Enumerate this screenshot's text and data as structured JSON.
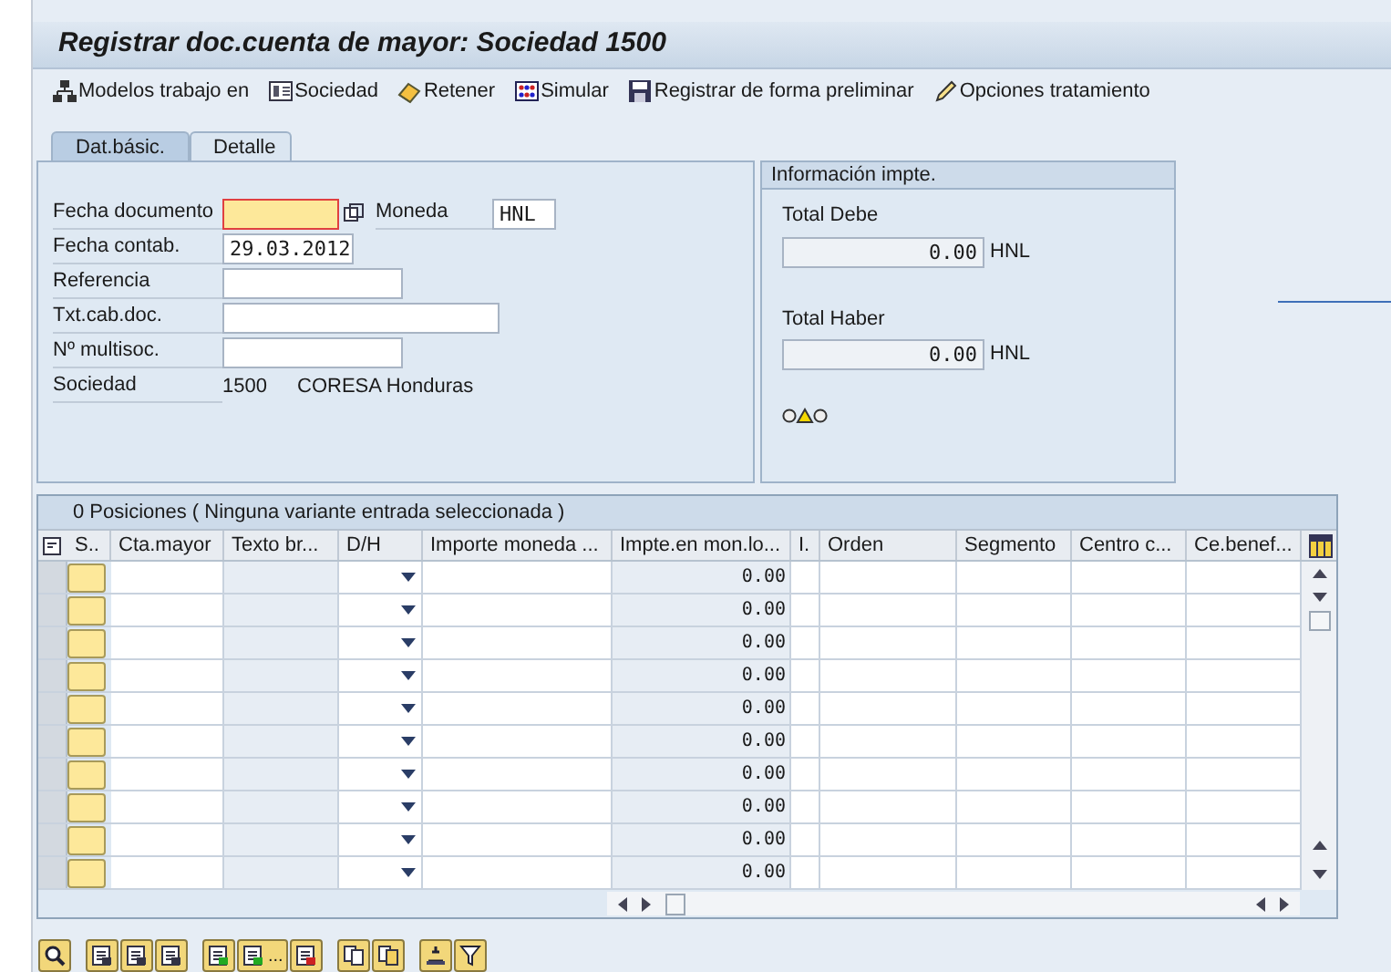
{
  "window": {
    "title": "Registrar doc.cuenta de mayor: Sociedad 1500"
  },
  "toolbar": [
    {
      "label": "Modelos trabajo en"
    },
    {
      "label": "Sociedad"
    },
    {
      "label": "Retener"
    },
    {
      "label": "Simular"
    },
    {
      "label": "Registrar de forma preliminar"
    },
    {
      "label": "Opciones tratamiento"
    }
  ],
  "tabs": [
    {
      "label": "Dat.básic.",
      "selected": true
    },
    {
      "label": "Detalle",
      "selected": false
    }
  ],
  "header": {
    "fecha_documento": {
      "label": "Fecha documento",
      "required": true
    },
    "moneda": {
      "label": "Moneda",
      "value": "HNL"
    },
    "fields": [
      {
        "label": "Fecha contab.",
        "value": "29.03.2012",
        "kind": "short"
      },
      {
        "label": "Referencia",
        "kind": "medium"
      },
      {
        "label": "Txt.cab.doc.",
        "kind": "long"
      },
      {
        "label": "Nº multisoc.",
        "kind": "medium"
      }
    ],
    "sociedad": {
      "label": "Sociedad",
      "code": "1500",
      "name": "CORESA Honduras"
    }
  },
  "info": {
    "title": "Información impte.",
    "totals": [
      {
        "label": "Total Debe",
        "value": "0.00",
        "currency": "HNL"
      },
      {
        "label": "Total Haber",
        "value": "0.00",
        "currency": "HNL"
      }
    ]
  },
  "table": {
    "title": "0 Posiciones ( Ninguna variante entrada seleccionada )",
    "columns": [
      "S..",
      "Cta.mayor",
      "Texto br...",
      "D/H",
      "Importe moneda ...",
      "Impte.en mon.lo...",
      "I.",
      "Orden",
      "Segmento",
      "Centro c...",
      "Ce.benef..."
    ],
    "rows": [
      {
        "impte": "0.00"
      },
      {
        "impte": "0.00"
      },
      {
        "impte": "0.00"
      },
      {
        "impte": "0.00"
      },
      {
        "impte": "0.00"
      },
      {
        "impte": "0.00"
      },
      {
        "impte": "0.00"
      },
      {
        "impte": "0.00"
      },
      {
        "impte": "0.00"
      },
      {
        "impte": "0.00"
      }
    ]
  },
  "bottom_toolbar": [
    [
      {
        "kind": "icon"
      }
    ],
    [
      {
        "kind": "icon"
      },
      {
        "kind": "icon"
      },
      {
        "kind": "icon"
      }
    ],
    [
      {
        "kind": "icon"
      },
      {
        "kind": "icon_text",
        "label": "..."
      },
      {
        "kind": "icon"
      }
    ],
    [
      {
        "kind": "icon"
      },
      {
        "kind": "icon"
      }
    ],
    [
      {
        "kind": "icon"
      },
      {
        "kind": "icon"
      }
    ]
  ]
}
